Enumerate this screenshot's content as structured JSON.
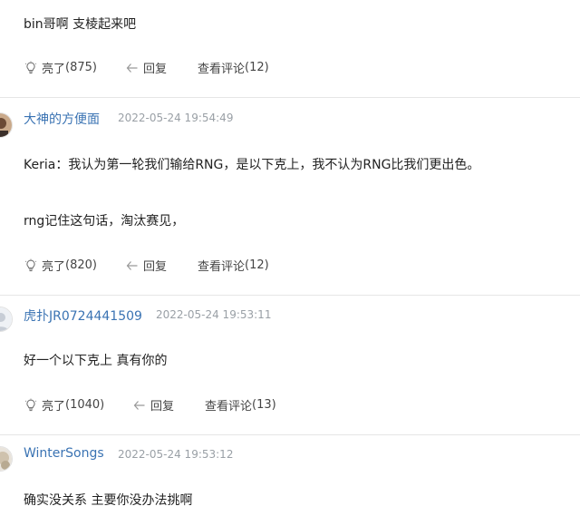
{
  "comments": [
    {
      "body": [
        "bin哥啊 支棱起来吧"
      ],
      "like_label": "亮了",
      "like_count": "(875)",
      "reply_label": "回复",
      "view_replies_label": "查看评论",
      "view_replies_count": "(12)"
    },
    {
      "author": "大神的方便面",
      "time": "2022-05-24 19:54:49",
      "body": [
        "Keria：我认为第一轮我们输给RNG，是以下克上，我不认为RNG比我们更出色。",
        "rng记住这句话，淘汰赛见，"
      ],
      "like_label": "亮了",
      "like_count": "(820)",
      "reply_label": "回复",
      "view_replies_label": "查看评论",
      "view_replies_count": "(12)"
    },
    {
      "author": "虎扑JR0724441509",
      "time": "2022-05-24 19:53:11",
      "body": [
        "好一个以下克上 真有你的"
      ],
      "like_label": "亮了",
      "like_count": "(1040)",
      "reply_label": "回复",
      "view_replies_label": "查看评论",
      "view_replies_count": "(13)"
    },
    {
      "author": "WinterSongs",
      "time": "2022-05-24 19:53:12",
      "body": [
        "确实没关系  主要你没办法挑啊"
      ]
    }
  ],
  "colors": {
    "author": "#3a73b3",
    "time": "#9aa0a6",
    "text": "#222222",
    "action": "#444444",
    "divider": "#e6e6e6"
  },
  "icons": {
    "like": "lightbulb-icon",
    "reply": "reply-arrow-icon"
  }
}
